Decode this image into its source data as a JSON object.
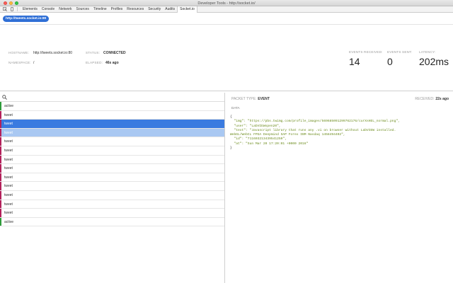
{
  "window": {
    "title": "Developer Tools - http://socket.io/"
  },
  "toolbar": {
    "tabs": [
      "Elements",
      "Console",
      "Network",
      "Sources",
      "Timeline",
      "Profiles",
      "Resources",
      "Security",
      "Audits",
      "Socket.io"
    ],
    "active_tab": "Socket.io"
  },
  "connection_url": "http://tweets.socket.io:80",
  "info": {
    "hostname_label": "HOSTNAME:",
    "hostname": "http://tweets.socket.io:80",
    "namespace_label": "NAMESPACE:",
    "namespace": "/",
    "status_label": "STATUS:",
    "status": "CONNECTED",
    "elapsed_label": "ELAPSED:",
    "elapsed": "46s ago",
    "events_received_label": "EVENTS RECEIVED:",
    "events_received": "14",
    "events_sent_label": "EVENTS SENT:",
    "events_sent": "0",
    "latency_label": "LATENCY:",
    "latency": "202ms"
  },
  "search": {
    "placeholder": ""
  },
  "events": [
    {
      "name": "active",
      "bar": "#2e9b3a"
    },
    {
      "name": "tweet",
      "bar": "#b3205a"
    },
    {
      "name": "tweet",
      "bar": "#b3205a",
      "state": "selected"
    },
    {
      "name": "tweet",
      "bar": "#b3205a",
      "state": "highlighted"
    },
    {
      "name": "tweet",
      "bar": "#b3205a"
    },
    {
      "name": "tweet",
      "bar": "#b3205a"
    },
    {
      "name": "tweet",
      "bar": "#b3205a"
    },
    {
      "name": "tweet",
      "bar": "#b3205a"
    },
    {
      "name": "tweet",
      "bar": "#b3205a"
    },
    {
      "name": "tweet",
      "bar": "#b3205a"
    },
    {
      "name": "tweet",
      "bar": "#b3205a"
    },
    {
      "name": "tweet",
      "bar": "#b3205a"
    },
    {
      "name": "tweet",
      "bar": "#b3205a"
    },
    {
      "name": "active",
      "bar": "#2e9b3a"
    }
  ],
  "detail": {
    "packet_type_label": "PACKET TYPE:",
    "packet_type": "EVENT",
    "received_label": "RECEIVED:",
    "received": "22s ago",
    "data_label": "DATA",
    "json_lines": [
      "{",
      "  \"img\": \"https://pbs.twimg.com/profile_images/569685091299762176/curXsHEL_normal.png\",",
      "  \"user\": \"LabVIEWopen20\",",
      "  \"text\": \"Javascript library that runs any .vi on browser without LabVIEW installed.",
      "WebGL/WebCL FPGA Deepmind SAP Forex IBM Nasdaq 1458494402\",",
      "  \"id\": \"711603213439541250\",",
      "  \"at\": \"Sun Mar 20 17:20:01 +0000 2016\"",
      "}"
    ]
  }
}
